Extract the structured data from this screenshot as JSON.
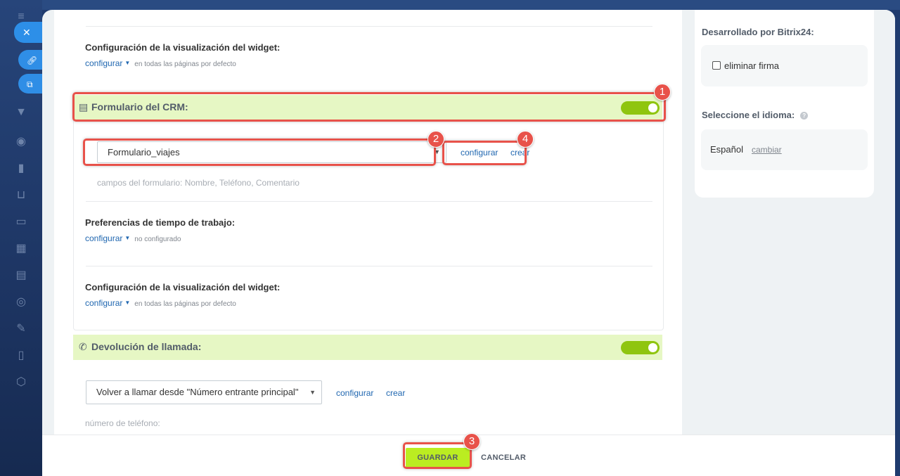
{
  "widget_display_1": {
    "title": "Configuración de la visualización del widget:",
    "link": "configurar",
    "note": "en todas las páginas por defecto"
  },
  "crm_form": {
    "title": "Formulario del CRM:",
    "enabled": true,
    "selected_form": "Formulario_viajes",
    "configure_link": "configurar",
    "create_link": "crear",
    "fields_hint": "campos del formulario: Nombre, Teléfono, Comentario"
  },
  "work_time": {
    "title": "Preferencias de tiempo de trabajo:",
    "link": "configurar",
    "note": "no configurado"
  },
  "widget_display_2": {
    "title": "Configuración de la visualización del widget:",
    "link": "configurar",
    "note": "en todas las páginas por defecto"
  },
  "callback": {
    "title": "Devolución de llamada:",
    "enabled": true,
    "selected": "Volver a llamar desde \"Número entrante principal\"",
    "configure_link": "configurar",
    "create_link": "crear",
    "phone_hint": "número de teléfono:"
  },
  "right_panel": {
    "developed_by": "Desarrollado por Bitrix24:",
    "remove_signature": "eliminar firma",
    "language_title": "Seleccione el idioma:",
    "language_value": "Español",
    "change_link": "cambiar"
  },
  "footer": {
    "save": "GUARDAR",
    "cancel": "CANCELAR"
  },
  "annotations": [
    "1",
    "2",
    "3",
    "4"
  ],
  "colors": {
    "accent_green": "#bbed21",
    "toggle_on": "#8fc50f",
    "section_bg": "#e6f7c4",
    "highlight": "#e8524a",
    "link": "#2067b0"
  },
  "icons": [
    "close-icon",
    "link-icon",
    "external-link-icon",
    "form-icon",
    "phone-callback-icon",
    "help-icon",
    "chevron-down-icon"
  ]
}
